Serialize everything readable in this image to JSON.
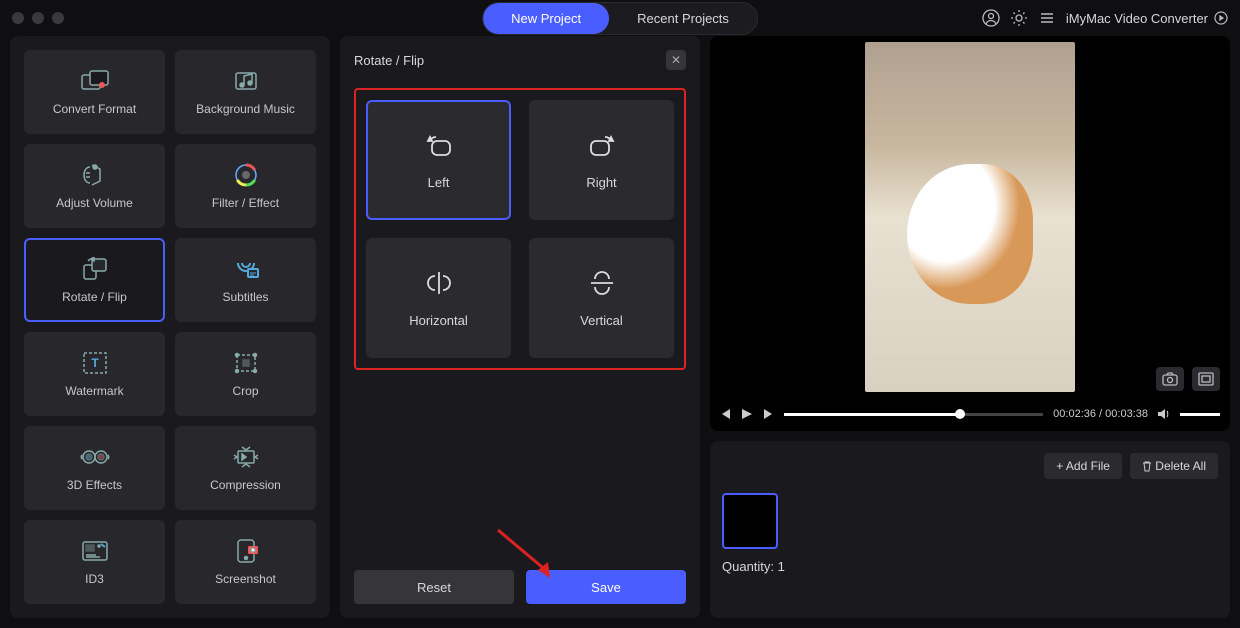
{
  "header": {
    "new_project": "New Project",
    "recent_projects": "Recent Projects",
    "app_name": "iMyMac Video Converter"
  },
  "sidebar": {
    "tools": [
      {
        "label": "Convert Format",
        "icon": "convert-icon"
      },
      {
        "label": "Background Music",
        "icon": "music-icon"
      },
      {
        "label": "Adjust Volume",
        "icon": "volume-icon"
      },
      {
        "label": "Filter / Effect",
        "icon": "filter-icon"
      },
      {
        "label": "Rotate / Flip",
        "icon": "rotate-icon",
        "active": true
      },
      {
        "label": "Subtitles",
        "icon": "subtitles-icon"
      },
      {
        "label": "Watermark",
        "icon": "watermark-icon"
      },
      {
        "label": "Crop",
        "icon": "crop-icon"
      },
      {
        "label": "3D Effects",
        "icon": "3d-icon"
      },
      {
        "label": "Compression",
        "icon": "compress-icon"
      },
      {
        "label": "ID3",
        "icon": "id3-icon"
      },
      {
        "label": "Screenshot",
        "icon": "screenshot-icon"
      }
    ]
  },
  "panel": {
    "title": "Rotate / Flip",
    "options": [
      {
        "label": "Left",
        "selected": true
      },
      {
        "label": "Right"
      },
      {
        "label": "Horizontal"
      },
      {
        "label": "Vertical"
      }
    ],
    "reset": "Reset",
    "save": "Save"
  },
  "player": {
    "current": "00:02:36",
    "total": "00:03:38",
    "sep": " / "
  },
  "files": {
    "add": "+  Add File",
    "delete": "Delete All",
    "quantity_label": "Quantity: ",
    "quantity": "1"
  }
}
